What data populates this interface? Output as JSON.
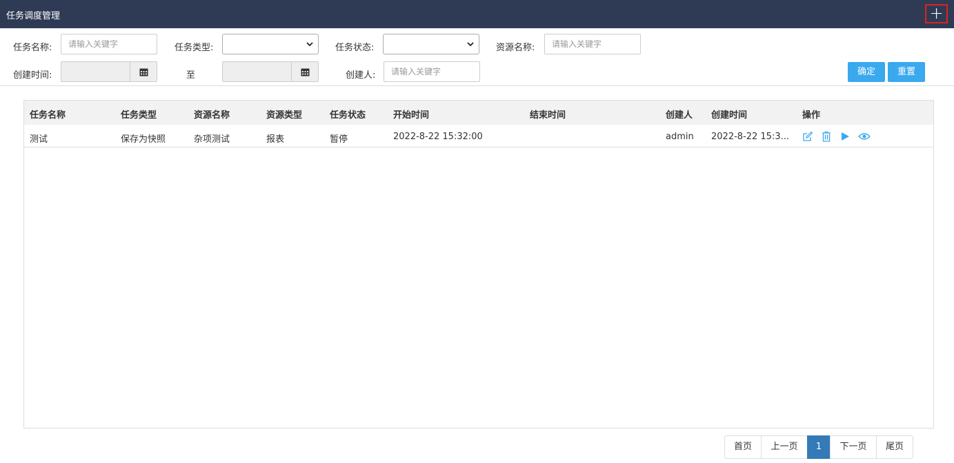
{
  "header": {
    "title": "任务调度管理",
    "add_icon": "plus-icon"
  },
  "filters": {
    "task_name": {
      "label": "任务名称:",
      "placeholder": "请输入关键字"
    },
    "task_type": {
      "label": "任务类型:",
      "value": ""
    },
    "task_status": {
      "label": "任务状态:",
      "value": ""
    },
    "resource_name": {
      "label": "资源名称:",
      "placeholder": "请输入关键字"
    },
    "create_time": {
      "label": "创建时间:",
      "to_label": "至",
      "calendar_icon": "calendar-icon"
    },
    "creator": {
      "label": "创建人:",
      "placeholder": "请输入关键字"
    },
    "confirm_label": "确定",
    "reset_label": "重置"
  },
  "table": {
    "columns": [
      "任务名称",
      "任务类型",
      "资源名称",
      "资源类型",
      "任务状态",
      "开始时间",
      "结束时间",
      "创建人",
      "创建时间",
      "操作"
    ],
    "rows": [
      {
        "task_name": "测试",
        "task_type": "保存为快照",
        "resource_name": "杂项测试",
        "resource_type": "报表",
        "task_status": "暂停",
        "start_time": "2022-8-22 15:32:00",
        "end_time": "",
        "creator": "admin",
        "create_time": "2022-8-22 15:3...",
        "actions": [
          "edit-icon",
          "delete-icon",
          "play-icon",
          "view-icon"
        ]
      }
    ]
  },
  "pagination": {
    "first": "首页",
    "prev": "上一页",
    "current": "1",
    "next": "下一页",
    "last": "尾页"
  },
  "colors": {
    "header_bg": "#2f3b55",
    "primary": "#3aa9ee",
    "page_active": "#337ab7",
    "highlight": "#e0221b"
  }
}
